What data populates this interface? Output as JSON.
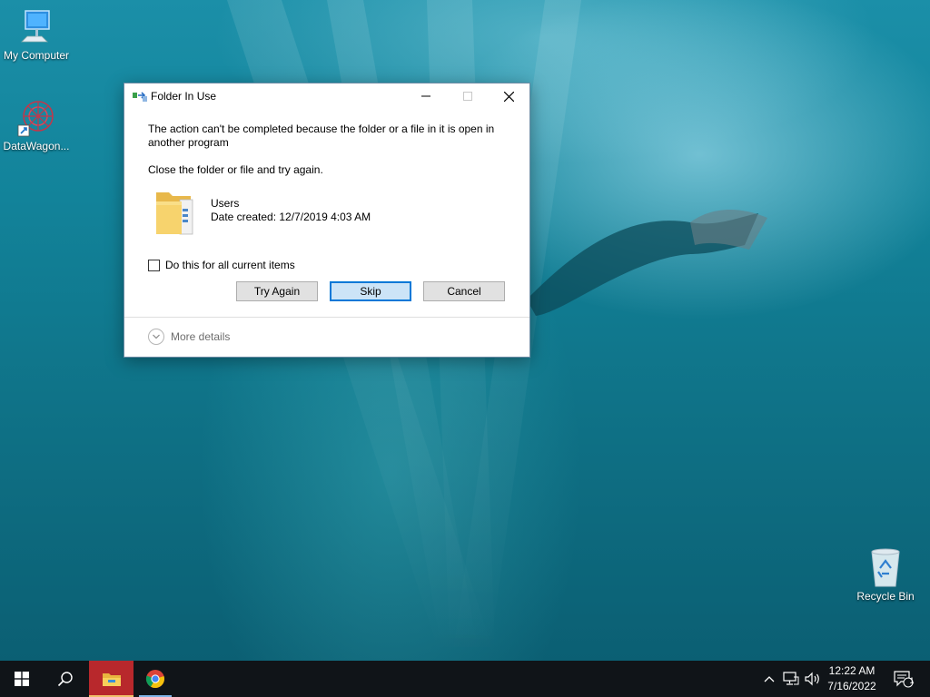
{
  "desktop": {
    "icons": [
      {
        "label": "My Computer"
      },
      {
        "label": "DataWagon..."
      },
      {
        "label": "Recycle Bin"
      }
    ]
  },
  "dialog": {
    "title": "Folder In Use",
    "message_main": "The action can't be completed because the folder or a file in it is open in another program",
    "message_hint": "Close the folder or file and try again.",
    "file_name": "Users",
    "file_date": "Date created: 12/7/2019 4:03 AM",
    "checkbox_label": "Do this for all current items",
    "checkbox_checked": false,
    "buttons": {
      "try_again": "Try Again",
      "skip": "Skip",
      "cancel": "Cancel"
    },
    "more_details": "More details"
  },
  "taskbar": {
    "time": "12:22 AM",
    "date": "7/16/2022",
    "notification_count": "1"
  },
  "colors": {
    "accent": "#0078d7",
    "taskbar": "#101418",
    "file_explorer_highlight": "#b8282c"
  }
}
